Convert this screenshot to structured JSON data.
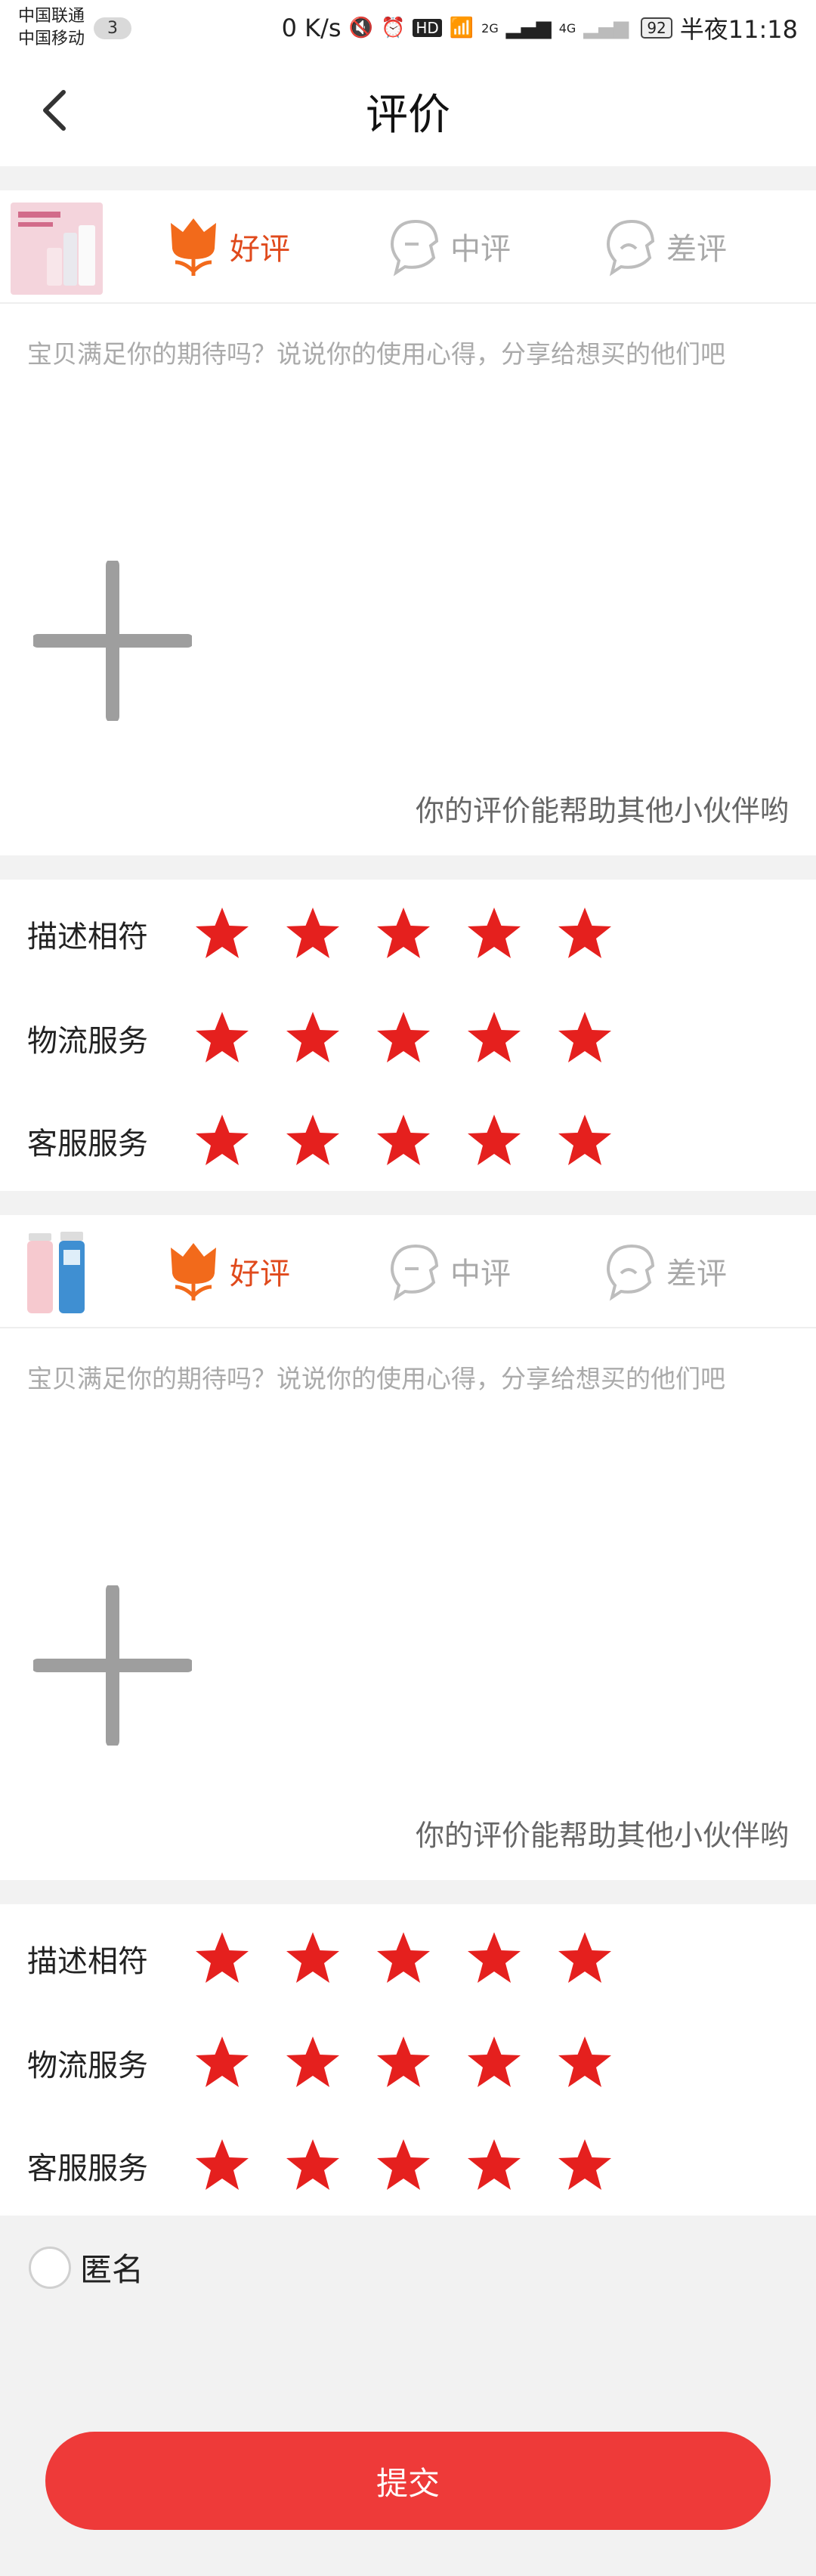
{
  "status_bar": {
    "carrier1": "中国联通",
    "carrier2": "中国移动",
    "sim_badge": "3",
    "speed": "0 K/s",
    "hd": "HD",
    "net1": "2G",
    "net2": "4G",
    "battery": "92",
    "time": "半夜11:18"
  },
  "nav": {
    "title": "评价"
  },
  "products": [
    {
      "good_label": "好评",
      "mid_label": "中评",
      "bad_label": "差评",
      "review_placeholder": "宝贝满足你的期待吗？说说你的使用心得，分享给想买的他们吧",
      "help_text": "你的评价能帮助其他小伙伴哟",
      "ratings": [
        {
          "label": "描述相符",
          "stars": 5
        },
        {
          "label": "物流服务",
          "stars": 5
        },
        {
          "label": "客服服务",
          "stars": 5
        }
      ]
    },
    {
      "good_label": "好评",
      "mid_label": "中评",
      "bad_label": "差评",
      "review_placeholder": "宝贝满足你的期待吗？说说你的使用心得，分享给想买的他们吧",
      "help_text": "你的评价能帮助其他小伙伴哟",
      "ratings": [
        {
          "label": "描述相符",
          "stars": 5
        },
        {
          "label": "物流服务",
          "stars": 5
        },
        {
          "label": "客服服务",
          "stars": 5
        }
      ]
    }
  ],
  "anonymous": {
    "label": "匿名",
    "checked": false
  },
  "submit_label": "提交",
  "colors": {
    "accent": "#ee3a39",
    "star": "#e5201e",
    "good": "#e04a1c",
    "muted": "#a9a9a9"
  },
  "icons": {
    "back": "chevron-left-icon",
    "good": "flower-good-icon",
    "mid": "face-neutral-icon",
    "bad": "face-bad-icon",
    "add": "plus-icon",
    "star": "star-icon"
  }
}
